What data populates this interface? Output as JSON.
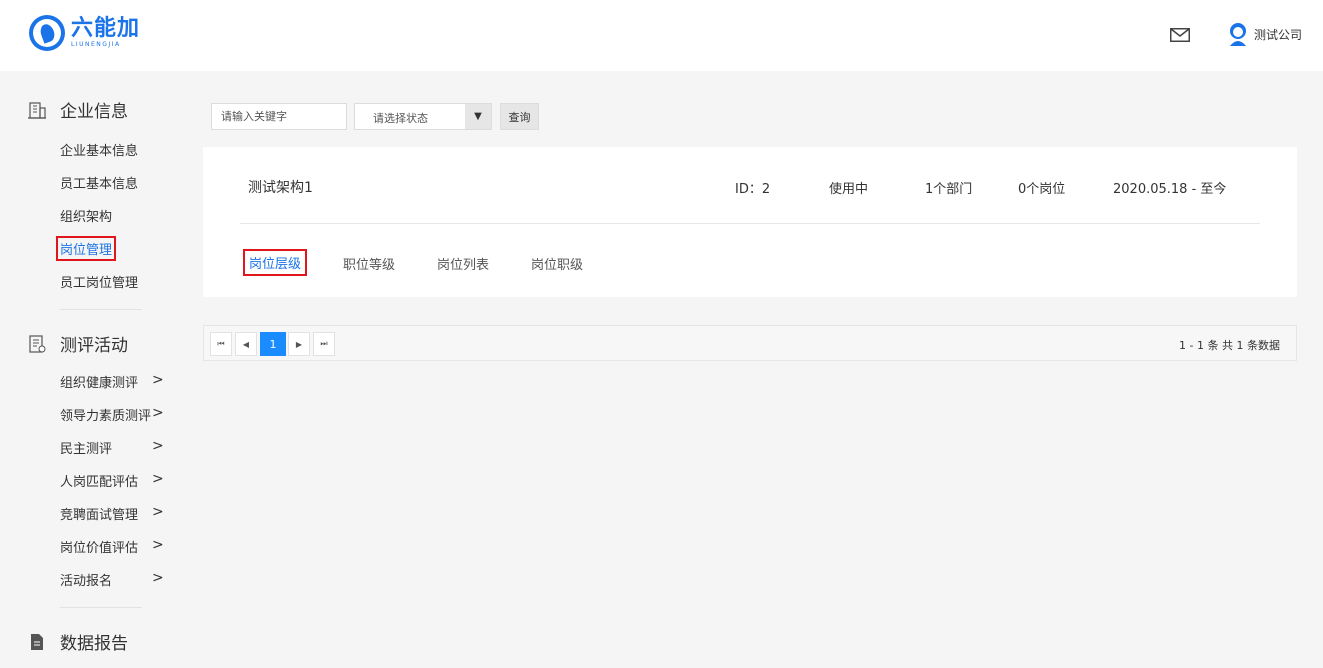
{
  "header": {
    "logo_cn": "六能加",
    "logo_en": "LIUNENGJIA",
    "user_name": "测试公司"
  },
  "sidebar": {
    "groups": [
      {
        "title": "企业信息",
        "icon": "building-icon",
        "items": [
          "企业基本信息",
          "员工基本信息",
          "组织架构",
          "岗位管理",
          "员工岗位管理"
        ]
      },
      {
        "title": "测评活动",
        "icon": "clipboard-icon",
        "items": [
          "组织健康测评",
          "领导力素质测评",
          "民主测评",
          "人岗匹配评估",
          "竞聘面试管理",
          "岗位价值评估",
          "活动报名"
        ]
      },
      {
        "title": "数据报告",
        "icon": "document-icon",
        "items": []
      }
    ],
    "active_item": "岗位管理",
    "chevron": ">"
  },
  "filters": {
    "keyword_placeholder": "请输入关键字",
    "status_placeholder": "请选择状态",
    "caret": "▼",
    "query_label": "查询"
  },
  "structure": {
    "name": "测试架构1",
    "id_text": "ID：2",
    "status": "使用中",
    "departments": "1个部门",
    "positions": "0个岗位",
    "date_range": "2020.05.18 - 至今"
  },
  "tabs": [
    "岗位层级",
    "职位等级",
    "岗位列表",
    "岗位职级"
  ],
  "active_tab": "岗位层级",
  "pagination": {
    "first": "⏮",
    "prev": "◀",
    "current_page": "1",
    "next": "▶",
    "last": "⏭",
    "summary": "1 - 1 条   共 1 条数据"
  },
  "colors": {
    "accent": "#1a73e8",
    "highlight_border": "#e0161c",
    "page_current": "#1a8cff"
  }
}
